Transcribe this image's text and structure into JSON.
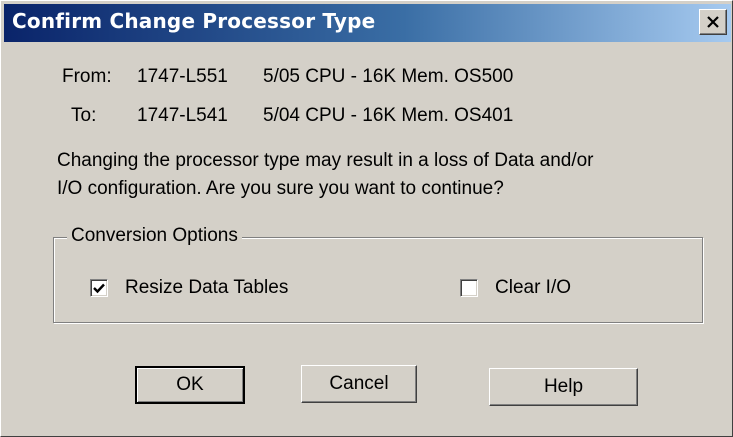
{
  "dialog": {
    "title": "Confirm Change Processor Type",
    "close_glyph": "✕"
  },
  "from": {
    "label": "From:",
    "catalog": "1747-L551",
    "description": "5/05 CPU - 16K Mem. OS500"
  },
  "to": {
    "label": "To:",
    "catalog": "1747-L541",
    "description": "5/04 CPU - 16K Mem. OS401"
  },
  "warning": {
    "line1": "Changing the processor type may result in a loss of Data and/or",
    "line2": "I/O configuration.  Are you sure you want to continue?"
  },
  "conversion_options": {
    "label": "Conversion Options",
    "resize_data_tables": {
      "label": "Resize Data Tables",
      "checked": true
    },
    "clear_io": {
      "label": "Clear I/O",
      "checked": false
    }
  },
  "buttons": {
    "ok": "OK",
    "cancel": "Cancel",
    "help": "Help"
  },
  "colors": {
    "title_start": "#0a246a",
    "title_end": "#a6caf0",
    "face": "#d4d0c8"
  }
}
